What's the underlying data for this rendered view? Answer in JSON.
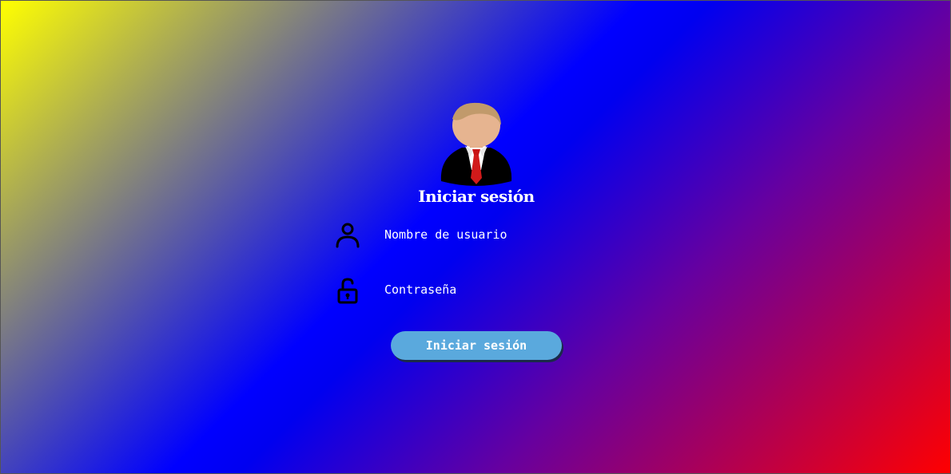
{
  "login": {
    "title": "Iniciar sesión",
    "username_placeholder": "Nombre de usuario",
    "password_placeholder": "Contraseña",
    "submit_label": "Iniciar sesión"
  },
  "icons": {
    "avatar": "user-avatar-icon",
    "username": "user-icon",
    "password": "unlock-icon"
  },
  "colors": {
    "button": "#5aa9dd",
    "text": "#ffffff"
  }
}
